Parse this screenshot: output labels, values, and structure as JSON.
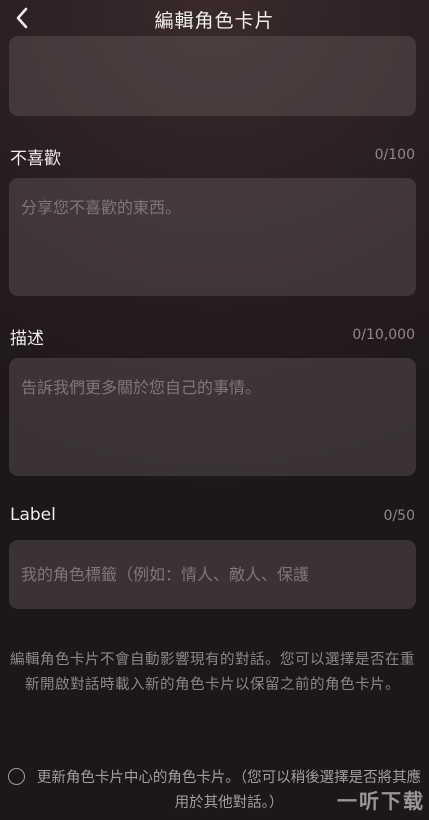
{
  "header": {
    "title": "編輯角色卡片",
    "back_icon": "chevron-left-icon"
  },
  "fields": {
    "dislikes": {
      "label": "不喜歡",
      "count": "0/100",
      "placeholder": "分享您不喜歡的東西。"
    },
    "description": {
      "label": "描述",
      "count": "0/10,000",
      "placeholder": "告訴我們更多關於您自己的事情。"
    },
    "label": {
      "label": "Label",
      "count": "0/50",
      "placeholder": "我的角色標籤（例如：情人、敵人、保護"
    }
  },
  "note": "編輯角色卡片不會自動影響現有的對話。您可以選擇是否在重新開啟對話時載入新的角色卡片以保留之前的角色卡片。",
  "update_option": {
    "text": "更新角色卡片中心的角色卡片。（您可以稍後選擇是否將其應用於其他對話。）",
    "checked": false
  },
  "watermark": "一听下载"
}
